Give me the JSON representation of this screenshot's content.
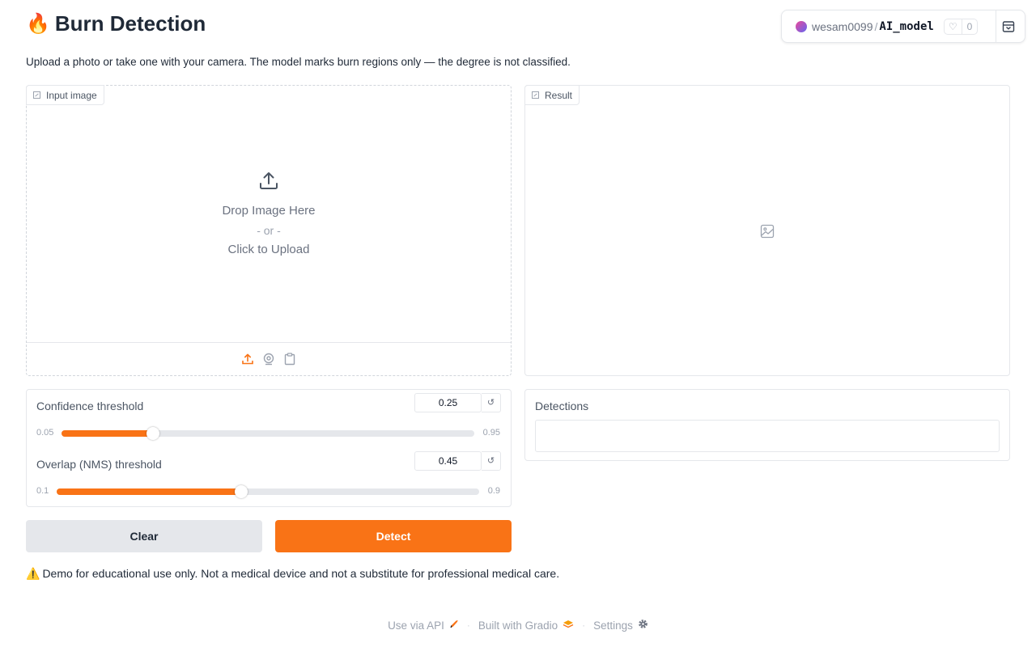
{
  "app": {
    "title": "Burn Detection",
    "title_icon": "fire-emoji",
    "description": "Upload a photo or take one with your camera. The model marks burn regions only — the degree is not classified."
  },
  "hf_badge": {
    "user": "wesam0099",
    "separator": "/",
    "repo": "AI_model",
    "likes": "0"
  },
  "input_image": {
    "label": "Input image",
    "drop_text": "Drop Image Here",
    "or_text": "- or -",
    "click_text": "Click to Upload",
    "sources": [
      "upload-icon",
      "webcam-icon",
      "clipboard-icon"
    ]
  },
  "result": {
    "label": "Result",
    "placeholder_icon": "image-icon"
  },
  "sliders": [
    {
      "label": "Confidence threshold",
      "value": "0.25",
      "min": "0.05",
      "max": "0.95",
      "reset_icon": "↺"
    },
    {
      "label": "Overlap (NMS) threshold",
      "value": "0.45",
      "min": "0.1",
      "max": "0.9",
      "reset_icon": "↺"
    }
  ],
  "detections": {
    "label": "Detections",
    "value": ""
  },
  "buttons": {
    "clear": "Clear",
    "detect": "Detect"
  },
  "disclaimer": {
    "icon": "⚠️",
    "text": "Demo for educational use only. Not a medical device and not a substitute for professional medical care."
  },
  "footer": {
    "api": "Use via API",
    "built": "Built with Gradio",
    "settings": "Settings"
  },
  "colors": {
    "accent": "#f97316",
    "border": "#e5e7eb",
    "muted_text": "#6b7280"
  }
}
